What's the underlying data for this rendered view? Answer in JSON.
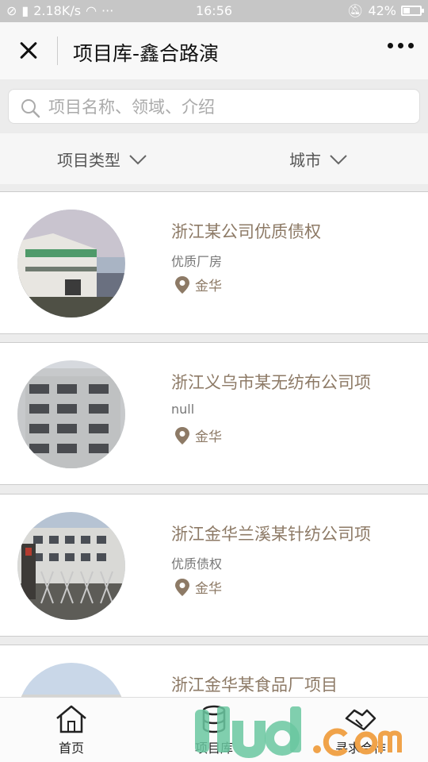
{
  "status": {
    "speed": "2.18K/s",
    "time": "16:56",
    "battery": "42%",
    "battery_fraction": 0.42
  },
  "header": {
    "title": "项目库-鑫合路演"
  },
  "search": {
    "placeholder": "项目名称、领域、介绍"
  },
  "filters": {
    "type_label": "项目类型",
    "city_label": "城市"
  },
  "projects": [
    {
      "name": "浙江某公司优质债权",
      "tag": "优质厂房",
      "location": "金华"
    },
    {
      "name": "浙江义乌市某无纺布公司项",
      "tag": "null",
      "location": "金华"
    },
    {
      "name": "浙江金华兰溪某针纺公司项",
      "tag": "优质债权",
      "location": "金华"
    },
    {
      "name": "浙江金华某食品厂项目",
      "tag": "",
      "location": ""
    }
  ],
  "nav": {
    "home": "首页",
    "library": "项目库",
    "cooperation": "寻求合作"
  },
  "colors": {
    "accent": "#8d7a66",
    "watermark_green": "#6ac7a0",
    "watermark_orange": "#f0a34a"
  }
}
